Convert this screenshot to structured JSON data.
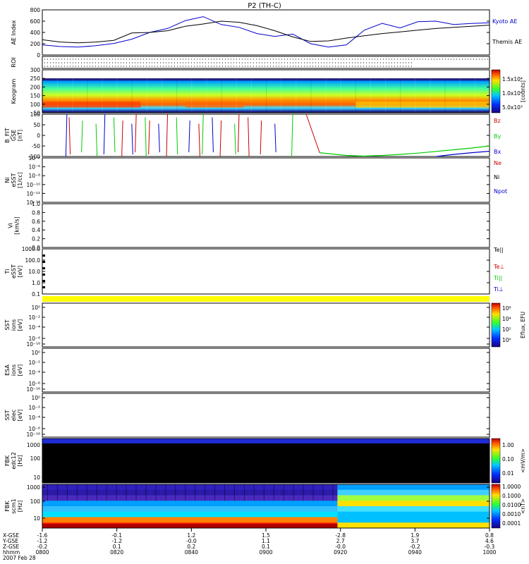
{
  "title": "P2 (TH-C)",
  "date": "2007 Feb 28",
  "colors": {
    "kyoto": "#0000cc",
    "themis": "#000000",
    "bx": "#0000cc",
    "by": "#00cc00",
    "bz": "#cc0000",
    "yellow": "#ffff00",
    "blue": "#1f2bd6",
    "black": "#000000"
  },
  "chart_data": [
    {
      "id": "ae",
      "type": "line",
      "ylabel": "AE Index",
      "ylim": [
        0,
        800
      ],
      "y_ticks": [
        "0",
        "200",
        "400",
        "600",
        "800"
      ],
      "x_hours": [
        9.0,
        10.0
      ],
      "series": [
        {
          "name": "Kyoto AE",
          "color": "#0000cc",
          "x": [
            9.0,
            9.04,
            9.08,
            9.12,
            9.16,
            9.2,
            9.24,
            9.28,
            9.32,
            9.36,
            9.4,
            9.44,
            9.48,
            9.52,
            9.56,
            9.6,
            9.64,
            9.68,
            9.72,
            9.76,
            9.8,
            9.84,
            9.88,
            9.92,
            9.96,
            10.0
          ],
          "y": [
            180,
            150,
            140,
            165,
            205,
            280,
            400,
            470,
            610,
            680,
            540,
            490,
            380,
            330,
            370,
            200,
            140,
            180,
            440,
            560,
            480,
            590,
            600,
            540,
            560,
            570
          ]
        },
        {
          "name": "Themis AE",
          "color": "#000000",
          "x": [
            9.0,
            9.04,
            9.08,
            9.12,
            9.16,
            9.2,
            9.24,
            9.28,
            9.32,
            9.36,
            9.4,
            9.44,
            9.48,
            9.52,
            9.56,
            9.6,
            9.64,
            9.68,
            9.72,
            9.76,
            9.8,
            9.84,
            9.88,
            9.92,
            9.96,
            10.0
          ],
          "y": [
            270,
            230,
            215,
            230,
            260,
            390,
            400,
            430,
            510,
            550,
            600,
            580,
            520,
            430,
            320,
            240,
            250,
            300,
            340,
            380,
            410,
            440,
            470,
            490,
            510,
            530
          ]
        }
      ]
    },
    {
      "id": "roi",
      "type": "table",
      "ylabel": "ROI"
    },
    {
      "id": "keogram",
      "type": "heatmap",
      "ylabel": "Keogram",
      "ylim": [
        50,
        300
      ],
      "y_ticks": [
        "50",
        "100",
        "150",
        "200",
        "250",
        "300"
      ],
      "colorbar_label": "[counts]",
      "colorbar_ticks": [
        "1.5x10⁴",
        "1.0x10⁴",
        "5.0x10³"
      ]
    },
    {
      "id": "bfit",
      "type": "line",
      "ylabel": "B_FIT",
      "ylabel2": "GSE",
      "ylabel3": "[nT]",
      "ylim": [
        -100,
        100
      ],
      "y_ticks": [
        "-100",
        "-50",
        "0",
        "50",
        "100"
      ],
      "series": [
        {
          "name": "Bz",
          "color": "#cc0000"
        },
        {
          "name": "By",
          "color": "#00cc00",
          "x": [
            9.62,
            9.68,
            9.72,
            9.76,
            9.8,
            9.84,
            9.88,
            9.92,
            9.96,
            10.0
          ],
          "y": [
            -82,
            -95,
            -98,
            -95,
            -90,
            -84,
            -76,
            -68,
            -60,
            -50
          ]
        },
        {
          "name": "Bx",
          "color": "#0000cc",
          "x": [
            9.88,
            9.92,
            9.96,
            10.0
          ],
          "y": [
            -100,
            -90,
            -82,
            -75
          ]
        }
      ]
    },
    {
      "id": "ni",
      "type": "line",
      "ylabel": "Ni",
      "ylabel2": "eSST",
      "ylabel3": "[1/cc]",
      "y_ticks": [
        "10⁻¹⁴",
        "10⁻¹²",
        "10⁻¹⁰",
        "10⁻⁸",
        "10⁻⁶",
        "10⁻⁴"
      ],
      "legend": [
        {
          "name": "Ne",
          "color": "#cc0000"
        },
        {
          "name": "Ni",
          "color": "#000000"
        },
        {
          "name": "Npot",
          "color": "#0000cc"
        }
      ]
    },
    {
      "id": "vi",
      "type": "line",
      "ylabel": "Vi",
      "ylabel2": "[km/s]",
      "y_ticks": [
        "0.0",
        "0.2",
        "0.4",
        "0.6",
        "0.8",
        "1.0"
      ]
    },
    {
      "id": "ti",
      "type": "line",
      "ylabel": "Ti",
      "ylabel2": "eSST",
      "ylabel3": "[eV]",
      "y_ticks": [
        "0.1",
        "1.0",
        "10.0",
        "100.0",
        "1000.0"
      ],
      "legend": [
        {
          "name": "Te||",
          "color": "#000000"
        },
        {
          "name": "Te⊥",
          "color": "#cc0000"
        },
        {
          "name": "Ti||",
          "color": "#00cc00"
        },
        {
          "name": "Ti⊥",
          "color": "#0000cc"
        }
      ]
    },
    {
      "id": "bar",
      "type": "table"
    },
    {
      "id": "sst1",
      "type": "heatmap",
      "ylabel": "SST",
      "ylabel2": "ions",
      "ylabel3": "[eV]",
      "y_ticks": [
        "10⁻¹⁶",
        "10⁻⁶",
        "10⁻⁴",
        "10⁻²",
        "10⁰"
      ],
      "colorbar_label": "Eflux, EFU",
      "colorbar_ticks": [
        "10⁶",
        "10⁴",
        "10²",
        "10⁰"
      ]
    },
    {
      "id": "esa",
      "type": "heatmap",
      "ylabel": "ESA",
      "ylabel2": "ions",
      "ylabel3": "[eV]",
      "y_ticks": [
        "10⁻¹⁶",
        "10⁻⁶",
        "10⁻⁴",
        "10⁻²",
        "10⁰"
      ]
    },
    {
      "id": "sst2",
      "type": "heatmap",
      "ylabel": "SST",
      "ylabel2": "elec",
      "ylabel3": "[eV]",
      "y_ticks": [
        "10⁻¹⁶",
        "10⁻⁶",
        "10⁻⁴",
        "10⁻²",
        "10⁰"
      ]
    },
    {
      "id": "fbk1",
      "type": "heatmap",
      "ylabel": "FBK",
      "ylabel2": "edc12",
      "ylabel3": "[Hz]",
      "y_ticks": [
        "10",
        "100",
        "1000"
      ],
      "colorbar_label": "<mV/m>",
      "colorbar_ticks": [
        "1.00",
        "0.10",
        "0.01"
      ]
    },
    {
      "id": "fbk2",
      "type": "heatmap",
      "ylabel": "FBK",
      "ylabel2": "scm1",
      "ylabel3": "[Hz]",
      "y_ticks": [
        "10",
        "100",
        "1000"
      ],
      "colorbar_label": "<nT>",
      "colorbar_ticks": [
        "1.0000",
        "0.1000",
        "0.0100",
        "0.0010",
        "0.0001"
      ]
    }
  ],
  "xaxis": {
    "row_labels": [
      "X-GSE",
      "Y-GSE",
      "Z-GSE",
      "hhmm",
      "2007 Feb 28"
    ],
    "columns": [
      {
        "values": [
          "-1.6",
          "-1.2",
          "-0.2",
          "0800"
        ]
      },
      {
        "values": [
          "-0.1",
          "-1.2",
          "0.1",
          "0820"
        ]
      },
      {
        "values": [
          "1.2",
          "-0.0",
          "0.2",
          "0840"
        ]
      },
      {
        "values": [
          "1.5",
          "1.1",
          "0.1",
          "0900"
        ]
      },
      {
        "values": [
          "-2.8",
          "2.7",
          "-0.0",
          "0920"
        ]
      },
      {
        "values": [
          "1.9",
          "3.7",
          "-0.2",
          "0940"
        ]
      },
      {
        "values": [
          "0.8",
          "4.6",
          "-0.3",
          "1000"
        ]
      }
    ]
  }
}
